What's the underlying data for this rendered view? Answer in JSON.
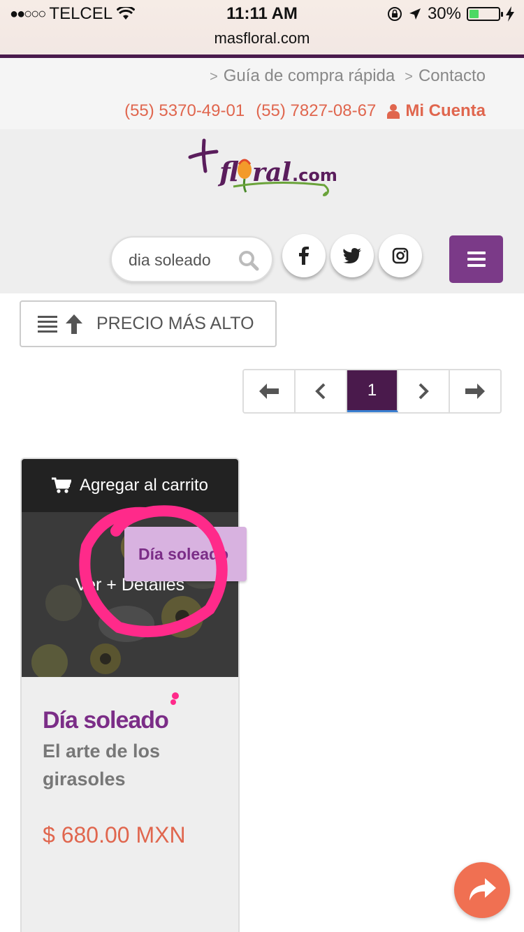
{
  "status_bar": {
    "carrier": "TELCEL",
    "time": "11:11 AM",
    "battery": "30%",
    "url": "masfloral.com"
  },
  "top_links": {
    "quick_guide": "Guía de compra rápida",
    "contact": "Contacto",
    "phone1": "(55) 5370-49-01",
    "phone2": "(55) 7827-08-67",
    "account": "Mi Cuenta"
  },
  "header": {
    "search_value": "dia soleado"
  },
  "sort": {
    "label": "PRECIO MÁS ALTO"
  },
  "pagination": {
    "current_page": "1"
  },
  "product": {
    "cart_label": "Agregar al carrito",
    "details_label": "Ver + Detalles",
    "name": "Día soleado",
    "subtitle": "El arte de los girasoles",
    "price": "$ 680.00 MXN"
  },
  "tooltip": {
    "text": "Día soleado"
  },
  "colors": {
    "brand_purple": "#7b3a88",
    "dark_purple": "#4a1a4c",
    "accent_orange": "#e0664e",
    "annotation_pink": "#ff2a8a"
  }
}
